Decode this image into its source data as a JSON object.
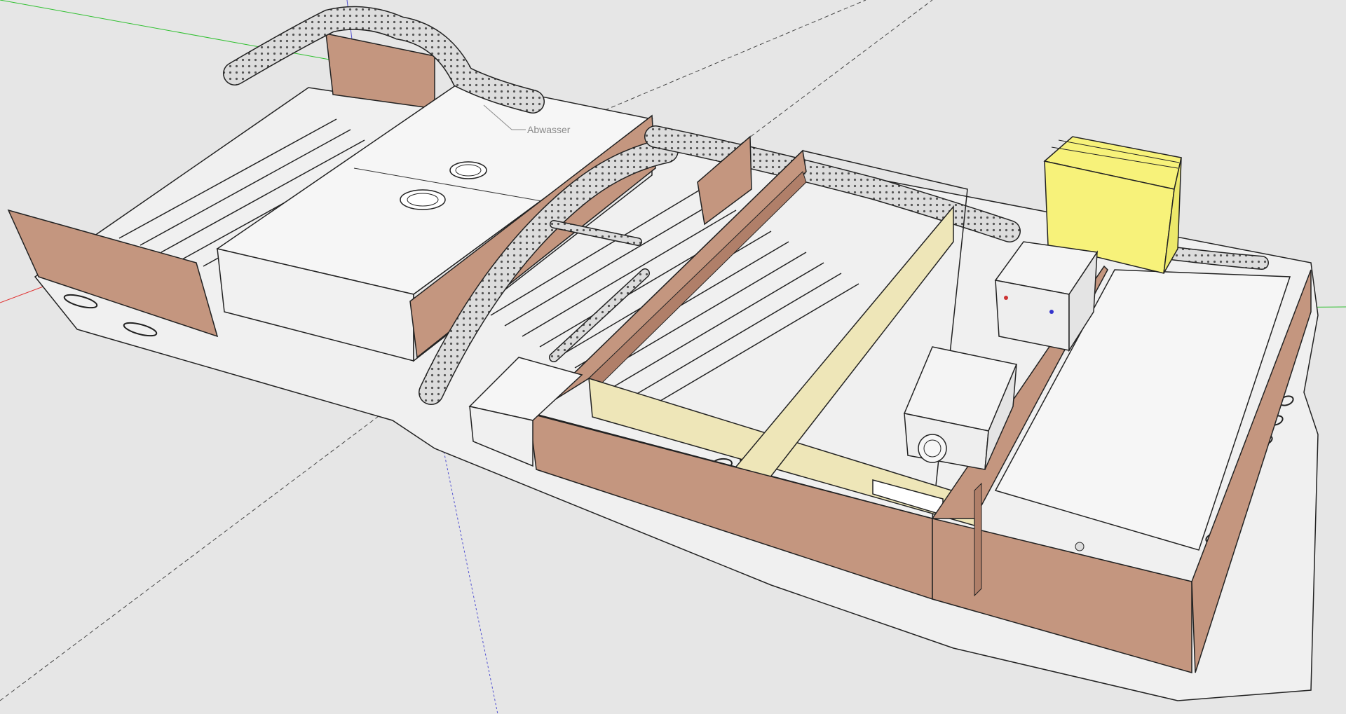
{
  "model_annotation": {
    "label": "Abwasser"
  },
  "colors": {
    "background": "#e6e6e6",
    "floor": "#f0f0f0",
    "wood_panel": "#c4967f",
    "wood_panel_dark": "#b07f69",
    "insulation_panel": "#eee6b8",
    "battery_yellow": "#f7f27a",
    "white_box": "#f4f4f4",
    "duct": "#d8d8d8",
    "axis_red": "#e03030",
    "axis_green": "#30c030",
    "axis_blue": "#3030e0"
  }
}
